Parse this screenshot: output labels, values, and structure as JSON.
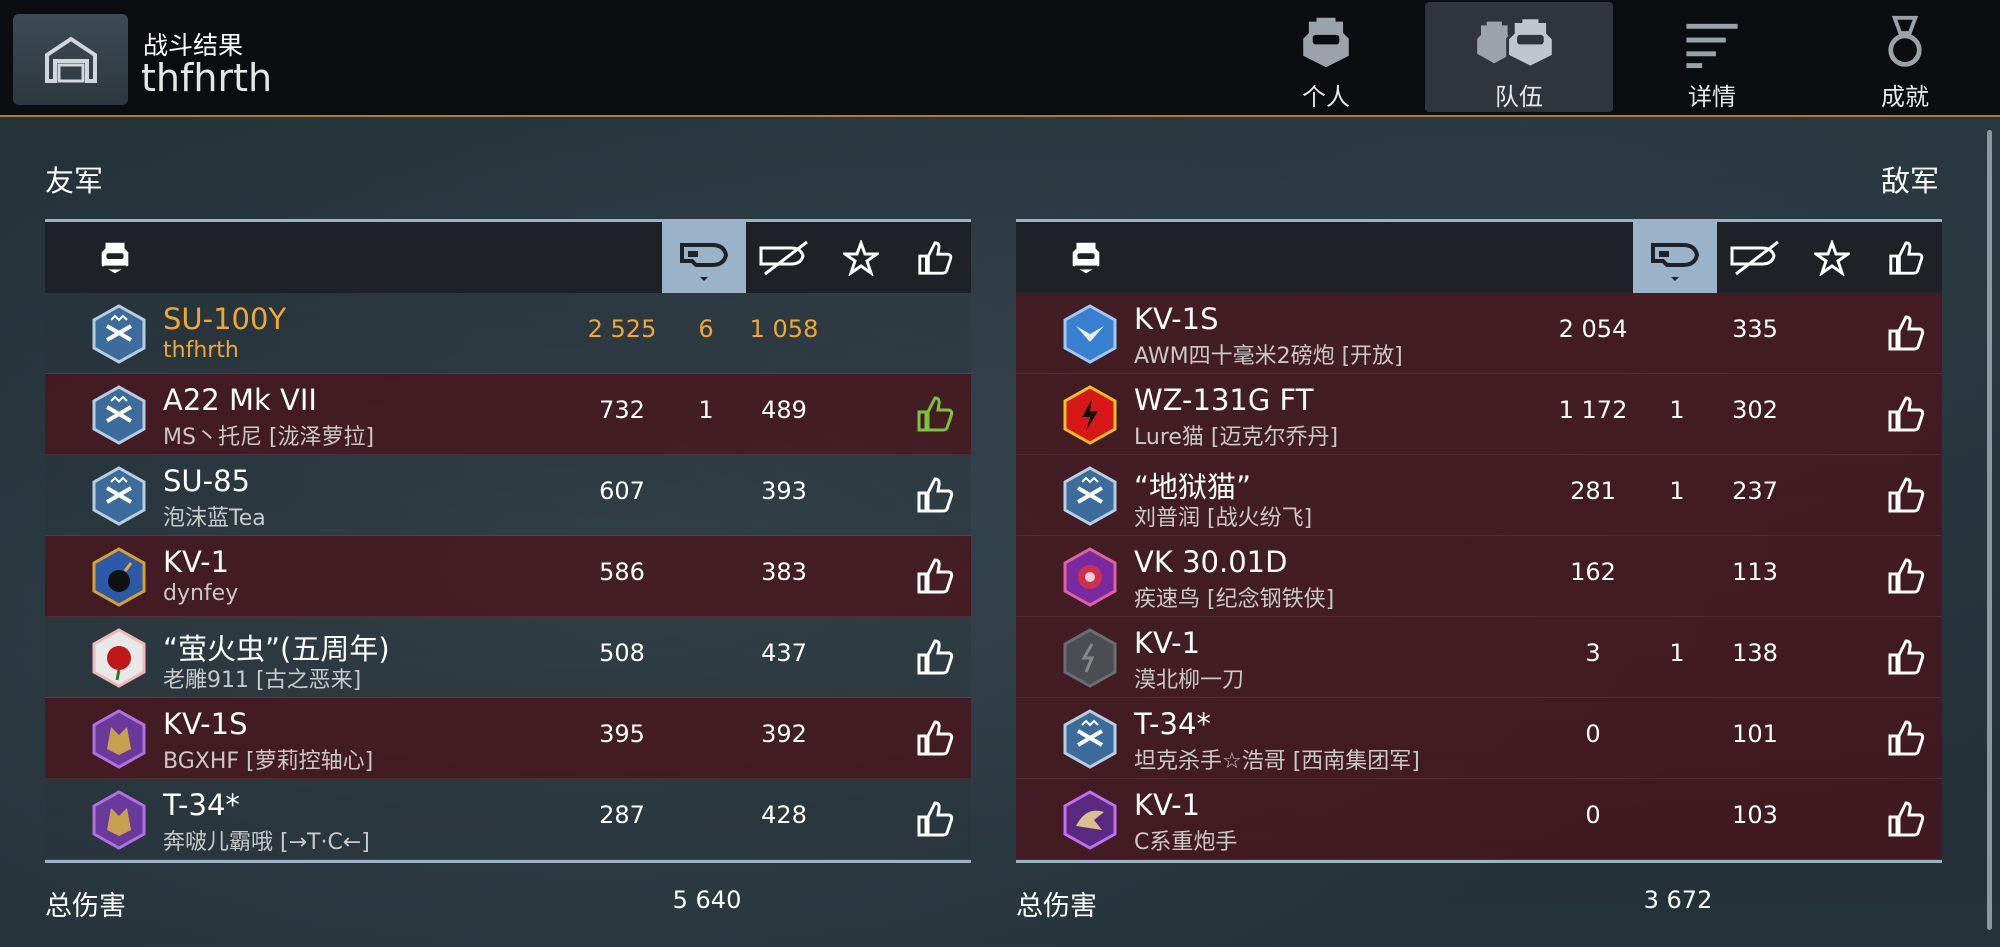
{
  "header": {
    "title": "战斗结果",
    "subtitle": "thfhrth",
    "tabs": [
      {
        "label": "个人",
        "icon": "soldier-icon"
      },
      {
        "label": "队伍",
        "icon": "team-icon",
        "active": true
      },
      {
        "label": "详情",
        "icon": "list-icon"
      },
      {
        "label": "成就",
        "icon": "medal-icon"
      }
    ]
  },
  "ally": {
    "title": "友军",
    "total_label": "总伤害",
    "total": "5 640",
    "rows": [
      {
        "tank": "SU-100Y",
        "player": "thfhrth",
        "damage": "2 525",
        "kills": "6",
        "score": "1 058",
        "liked": false,
        "self": true,
        "badge": "td"
      },
      {
        "tank": "A22 Mk VII",
        "player": "MS丶托尼 [泷泽萝拉]",
        "damage": "732",
        "kills": "1",
        "score": "489",
        "liked": true,
        "badge": "td"
      },
      {
        "tank": "SU-85",
        "player": "泡沫蓝Tea",
        "damage": "607",
        "kills": "",
        "score": "393",
        "liked": false,
        "badge": "td"
      },
      {
        "tank": "KV-1",
        "player": "dynfey",
        "damage": "586",
        "kills": "",
        "score": "383",
        "liked": false,
        "badge": "bomb"
      },
      {
        "tank": "“萤火虫”(五周年)",
        "player": "老雕911 [古之恶来]",
        "damage": "508",
        "kills": "",
        "score": "437",
        "liked": false,
        "badge": "rose"
      },
      {
        "tank": "KV-1S",
        "player": "BGXHF [萝莉控轴心]",
        "damage": "395",
        "kills": "",
        "score": "392",
        "liked": false,
        "badge": "wolf"
      },
      {
        "tank": "T-34*",
        "player": "奔啵儿霸哦 [→T·C←]",
        "damage": "287",
        "kills": "",
        "score": "428",
        "liked": false,
        "badge": "wolf"
      }
    ]
  },
  "enemy": {
    "title": "敌军",
    "total_label": "总伤害",
    "total": "3 672",
    "rows": [
      {
        "tank": "KV-1S",
        "player": "AWM四十毫米2磅炮 [开放]",
        "damage": "2 054",
        "kills": "",
        "score": "335",
        "badge": "wings"
      },
      {
        "tank": "WZ-131G FT",
        "player": "Lure猫 [迈克尔乔丹]",
        "damage": "1 172",
        "kills": "1",
        "score": "302",
        "badge": "bolt"
      },
      {
        "tank": "“地狱猫”",
        "player": "刘普润 [战火纷飞]",
        "damage": "281",
        "kills": "1",
        "score": "237",
        "badge": "td"
      },
      {
        "tank": "VK 30.01D",
        "player": "疾速鸟 [纪念钢铁侠]",
        "damage": "162",
        "kills": "",
        "score": "113",
        "badge": "dragon"
      },
      {
        "tank": "KV-1",
        "player": "漠北柳一刀",
        "damage": "3",
        "kills": "1",
        "score": "138",
        "badge": "grey"
      },
      {
        "tank": "T-34*",
        "player": "坦克杀手☆浩哥 [西南集团军]",
        "damage": "0",
        "kills": "",
        "score": "101",
        "badge": "td"
      },
      {
        "tank": "KV-1",
        "player": "C系重炮手",
        "damage": "0",
        "kills": "",
        "score": "103",
        "badge": "eagle"
      }
    ]
  },
  "colors": {
    "accent": "#f0a830",
    "header_col": "#9ab3c9",
    "liked": "#7cc23a",
    "row_dark": "#48161c"
  }
}
